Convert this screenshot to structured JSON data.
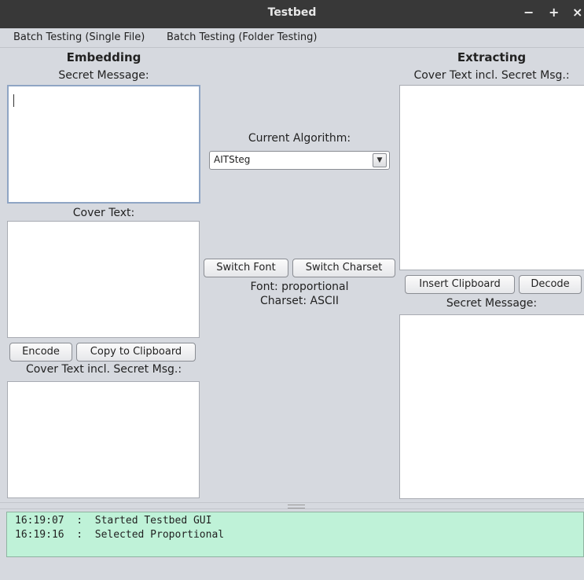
{
  "window": {
    "title": "Testbed",
    "minimize": "−",
    "maximize": "+",
    "close": "×"
  },
  "menu": {
    "items": [
      "Batch Testing (Single File)",
      "Batch Testing (Folder Testing)"
    ]
  },
  "embedding": {
    "heading": "Embedding",
    "secret_label": "Secret Message:",
    "secret_value": "",
    "cover_label": "Cover Text:",
    "cover_value": "",
    "encode_button": "Encode",
    "copy_button": "Copy to Clipboard",
    "output_label": "Cover Text incl. Secret Msg.:",
    "output_value": ""
  },
  "middle": {
    "algorithm_label": "Current Algorithm:",
    "algorithm_value": "AITSteg",
    "switch_font_button": "Switch Font",
    "switch_charset_button": "Switch Charset",
    "font_status": "Font: proportional",
    "charset_status": "Charset: ASCII"
  },
  "extracting": {
    "heading": "Extracting",
    "input_label": "Cover Text incl. Secret Msg.:",
    "input_value": "",
    "insert_button": "Insert Clipboard",
    "decode_button": "Decode",
    "secret_label": "Secret Message:",
    "secret_value": ""
  },
  "log": {
    "lines": [
      "16:19:07  :  Started Testbed GUI",
      "16:19:16  :  Selected Proportional"
    ]
  }
}
